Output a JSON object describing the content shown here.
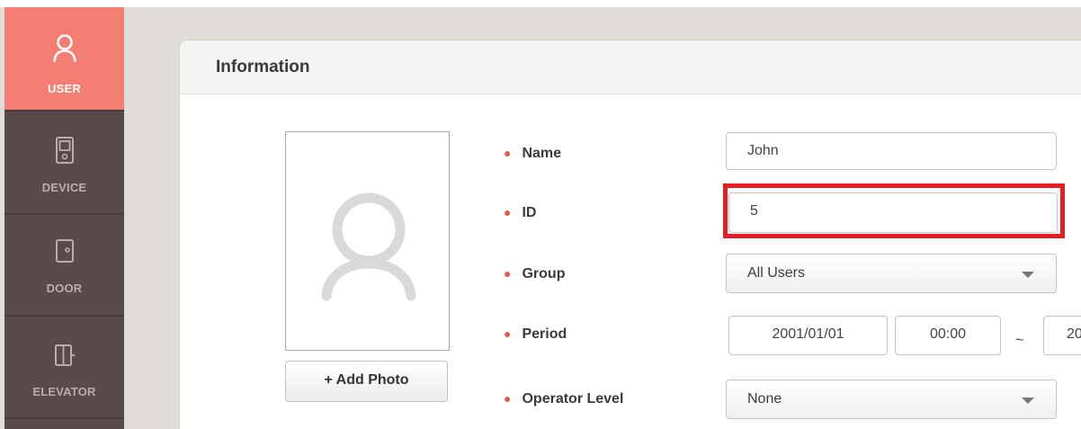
{
  "sidebar": {
    "items": [
      {
        "label": "USER",
        "icon": "user-icon",
        "active": true
      },
      {
        "label": "DEVICE",
        "icon": "device-icon",
        "active": false
      },
      {
        "label": "DOOR",
        "icon": "door-icon",
        "active": false
      },
      {
        "label": "ELEVATOR",
        "icon": "elevator-icon",
        "active": false
      }
    ]
  },
  "panel": {
    "title": "Information",
    "photo_placeholder_icon": "user-silhouette-icon",
    "add_photo_label": "+ Add Photo"
  },
  "form": {
    "name": {
      "label": "Name",
      "value": "John"
    },
    "id": {
      "label": "ID",
      "value": "5"
    },
    "group": {
      "label": "Group",
      "value": "All Users"
    },
    "period": {
      "label": "Period",
      "start_date": "2001/01/01",
      "start_time": "00:00",
      "separator": "~",
      "end_date": "20"
    },
    "operator_level": {
      "label": "Operator Level",
      "value": "None"
    }
  },
  "colors": {
    "sidebar_bg": "#5a4a4c",
    "active_nav": "#f47e73",
    "required_dot": "#e85a4f",
    "highlight": "#e21d24"
  }
}
